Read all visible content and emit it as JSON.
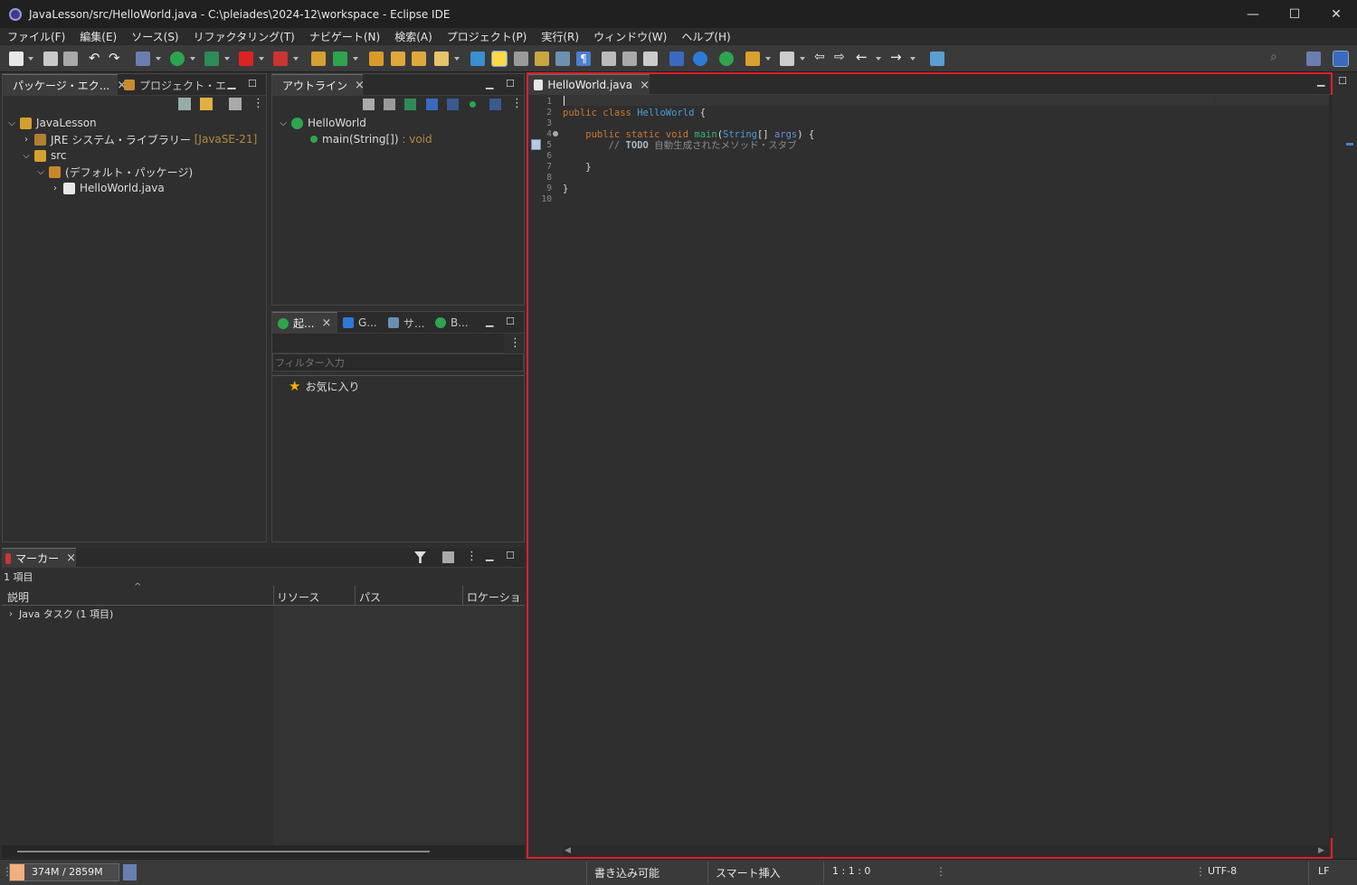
{
  "window": {
    "title": "JavaLesson/src/HelloWorld.java - C:\\pleiades\\2024-12\\workspace - Eclipse IDE",
    "minimize": "—",
    "maximize": "☐",
    "close": "✕"
  },
  "menu": [
    "ファイル(F)",
    "編集(E)",
    "ソース(S)",
    "リファクタリング(T)",
    "ナビゲート(N)",
    "検索(A)",
    "プロジェクト(P)",
    "実行(R)",
    "ウィンドウ(W)",
    "ヘルプ(H)"
  ],
  "package_explorer": {
    "tabs": [
      "パッケージ・エク...",
      "プロジェクト・エ..."
    ],
    "tree": {
      "project": "JavaLesson",
      "jre": "JRE システム・ライブラリー",
      "jre_version": "[JavaSE-21]",
      "src": "src",
      "package": "(デフォルト・パッケージ)",
      "file": "HelloWorld.java"
    }
  },
  "outline": {
    "tab": "アウトライン",
    "class": "HelloWorld",
    "method": "main(String[])",
    "method_type": ": void"
  },
  "launch_panel": {
    "tabs": [
      "起...",
      "G...",
      "サ...",
      "B..."
    ],
    "filter_placeholder": "フィルター入力",
    "favorites": "お気に入り"
  },
  "markers": {
    "tab": "マーカー",
    "count": "1 項目",
    "columns": [
      "説明",
      "リソース",
      "パス",
      "ロケーション"
    ],
    "rows": [
      "Java タスク (1 項目)"
    ]
  },
  "editor": {
    "tab": "HelloWorld.java",
    "line_numbers": [
      "1",
      "2",
      "3",
      "4",
      "5",
      "6",
      "7",
      "8",
      "9",
      "10"
    ],
    "lines": {
      "l2_kw": "public class ",
      "l2_name": "HelloWorld",
      "l2_rest": " {",
      "l4_kw": "    public static void ",
      "l4_fn": "main",
      "l4_p1": "(",
      "l4_type": "String",
      "l4_p2": "[] ",
      "l4_arg": "args",
      "l4_rest": ") {",
      "l5_comment": "        // ",
      "l5_todo": "TODO",
      "l5_text": " 自動生成されたメソッド・スタブ",
      "l7": "    }",
      "l9": "}"
    }
  },
  "statusbar": {
    "memory": "374M / 2859M",
    "memory_used_fraction": 0.13,
    "writable": "書き込み可能",
    "insert_mode": "スマート挿入",
    "position": "1 : 1 : 0",
    "encoding": "UTF-8",
    "line_ending": "LF"
  },
  "colors": {
    "highlight_border": "#e0202a",
    "accent": "#4a9fd8"
  }
}
